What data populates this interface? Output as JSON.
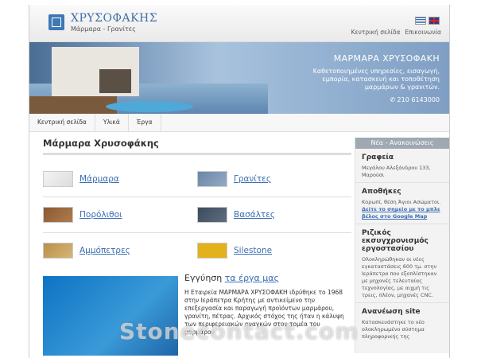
{
  "header": {
    "title": "ΧΡΥΣΟΦΑΚΗΣ",
    "subtitle": "Μάρμαρα - Γρανίτες",
    "links": [
      "Κεντρική σελίδα",
      "Επικοινωνία"
    ]
  },
  "banner": {
    "title": "ΜΑΡΜΑΡΑ ΧΡΥΣΟΦΑΚΗ",
    "text": "Καθετοποιημένες υπηρεσίες, εισαγωγή, εμπορία, κατασκευή και τοποθέτηση μαρμάρων & γρανιτών.",
    "phone": "✆ 210 6143000"
  },
  "nav": [
    "Κεντρική σελίδα",
    "Υλικά",
    "Έργα"
  ],
  "main": {
    "title": "Μάρμαρα Χρυσοφάκης",
    "products": [
      {
        "label": "Μάρμαρα",
        "swatch": "#e8e8e8"
      },
      {
        "label": "Γρανίτες",
        "swatch": "#7e98b7"
      },
      {
        "label": "Πορόλιθοι",
        "swatch": "#9c6a3f"
      },
      {
        "label": "Βασάλτες",
        "swatch": "#4c5b6b"
      },
      {
        "label": "Αμμόπετρες",
        "swatch": "#c7a261"
      },
      {
        "label": "Silestone",
        "swatch": "#e2b11c"
      }
    ],
    "warranty_title": "Εγγύηση",
    "warranty_link": "τα έργα μας",
    "warranty_text": "Η Εταιρεία ΜΑΡΜΑΡΑ ΧΡΥΣΟΦΑΚΗ ιδρύθηκε το 1968 στην Ιεράπετρα Κρήτης με αντικείμενο την επεξεργασία και παραγωγή προϊόντων μαρμάρου, γρανίτη, πέτρας. Αρχικός στόχος της ήταν η κάλυψη των περιφερειακών αναγκών στον τομέα του μαρμάρου"
  },
  "sidebar": {
    "header": "Νέα - Ανακοινώσεις",
    "blocks": [
      {
        "title": "Γραφεία",
        "text": "Μεγάλου Αλεξάνδρου 133, Μαρούσι",
        "link": ""
      },
      {
        "title": "Αποθήκες",
        "text": "Κορωπί, θέση Άγιοι Ασώματοι.",
        "link": "Δείτε το σημείο με το μπλε βέλος στο Google Map"
      },
      {
        "title": "Ριζικός εκσυγχρονισμός εργοστασίου",
        "text": "Ολοκληρώθηκαν οι νέες εγκαταστάσεις 600 τμ. στην Ιεράπετρα που εξοπλίστηκαν με μηχανές τελευταίας τεχνολογίας, με αιχμή τις τρεις, πλέον, μηχανές CNC.",
        "link": ""
      },
      {
        "title": "Ανανέωση site",
        "text": "Κατασκευάστηκε το νέο ολοκληρωμένο σύστημα πληροφορικής της",
        "link": ""
      }
    ]
  },
  "watermark": "Stonecontact.com"
}
